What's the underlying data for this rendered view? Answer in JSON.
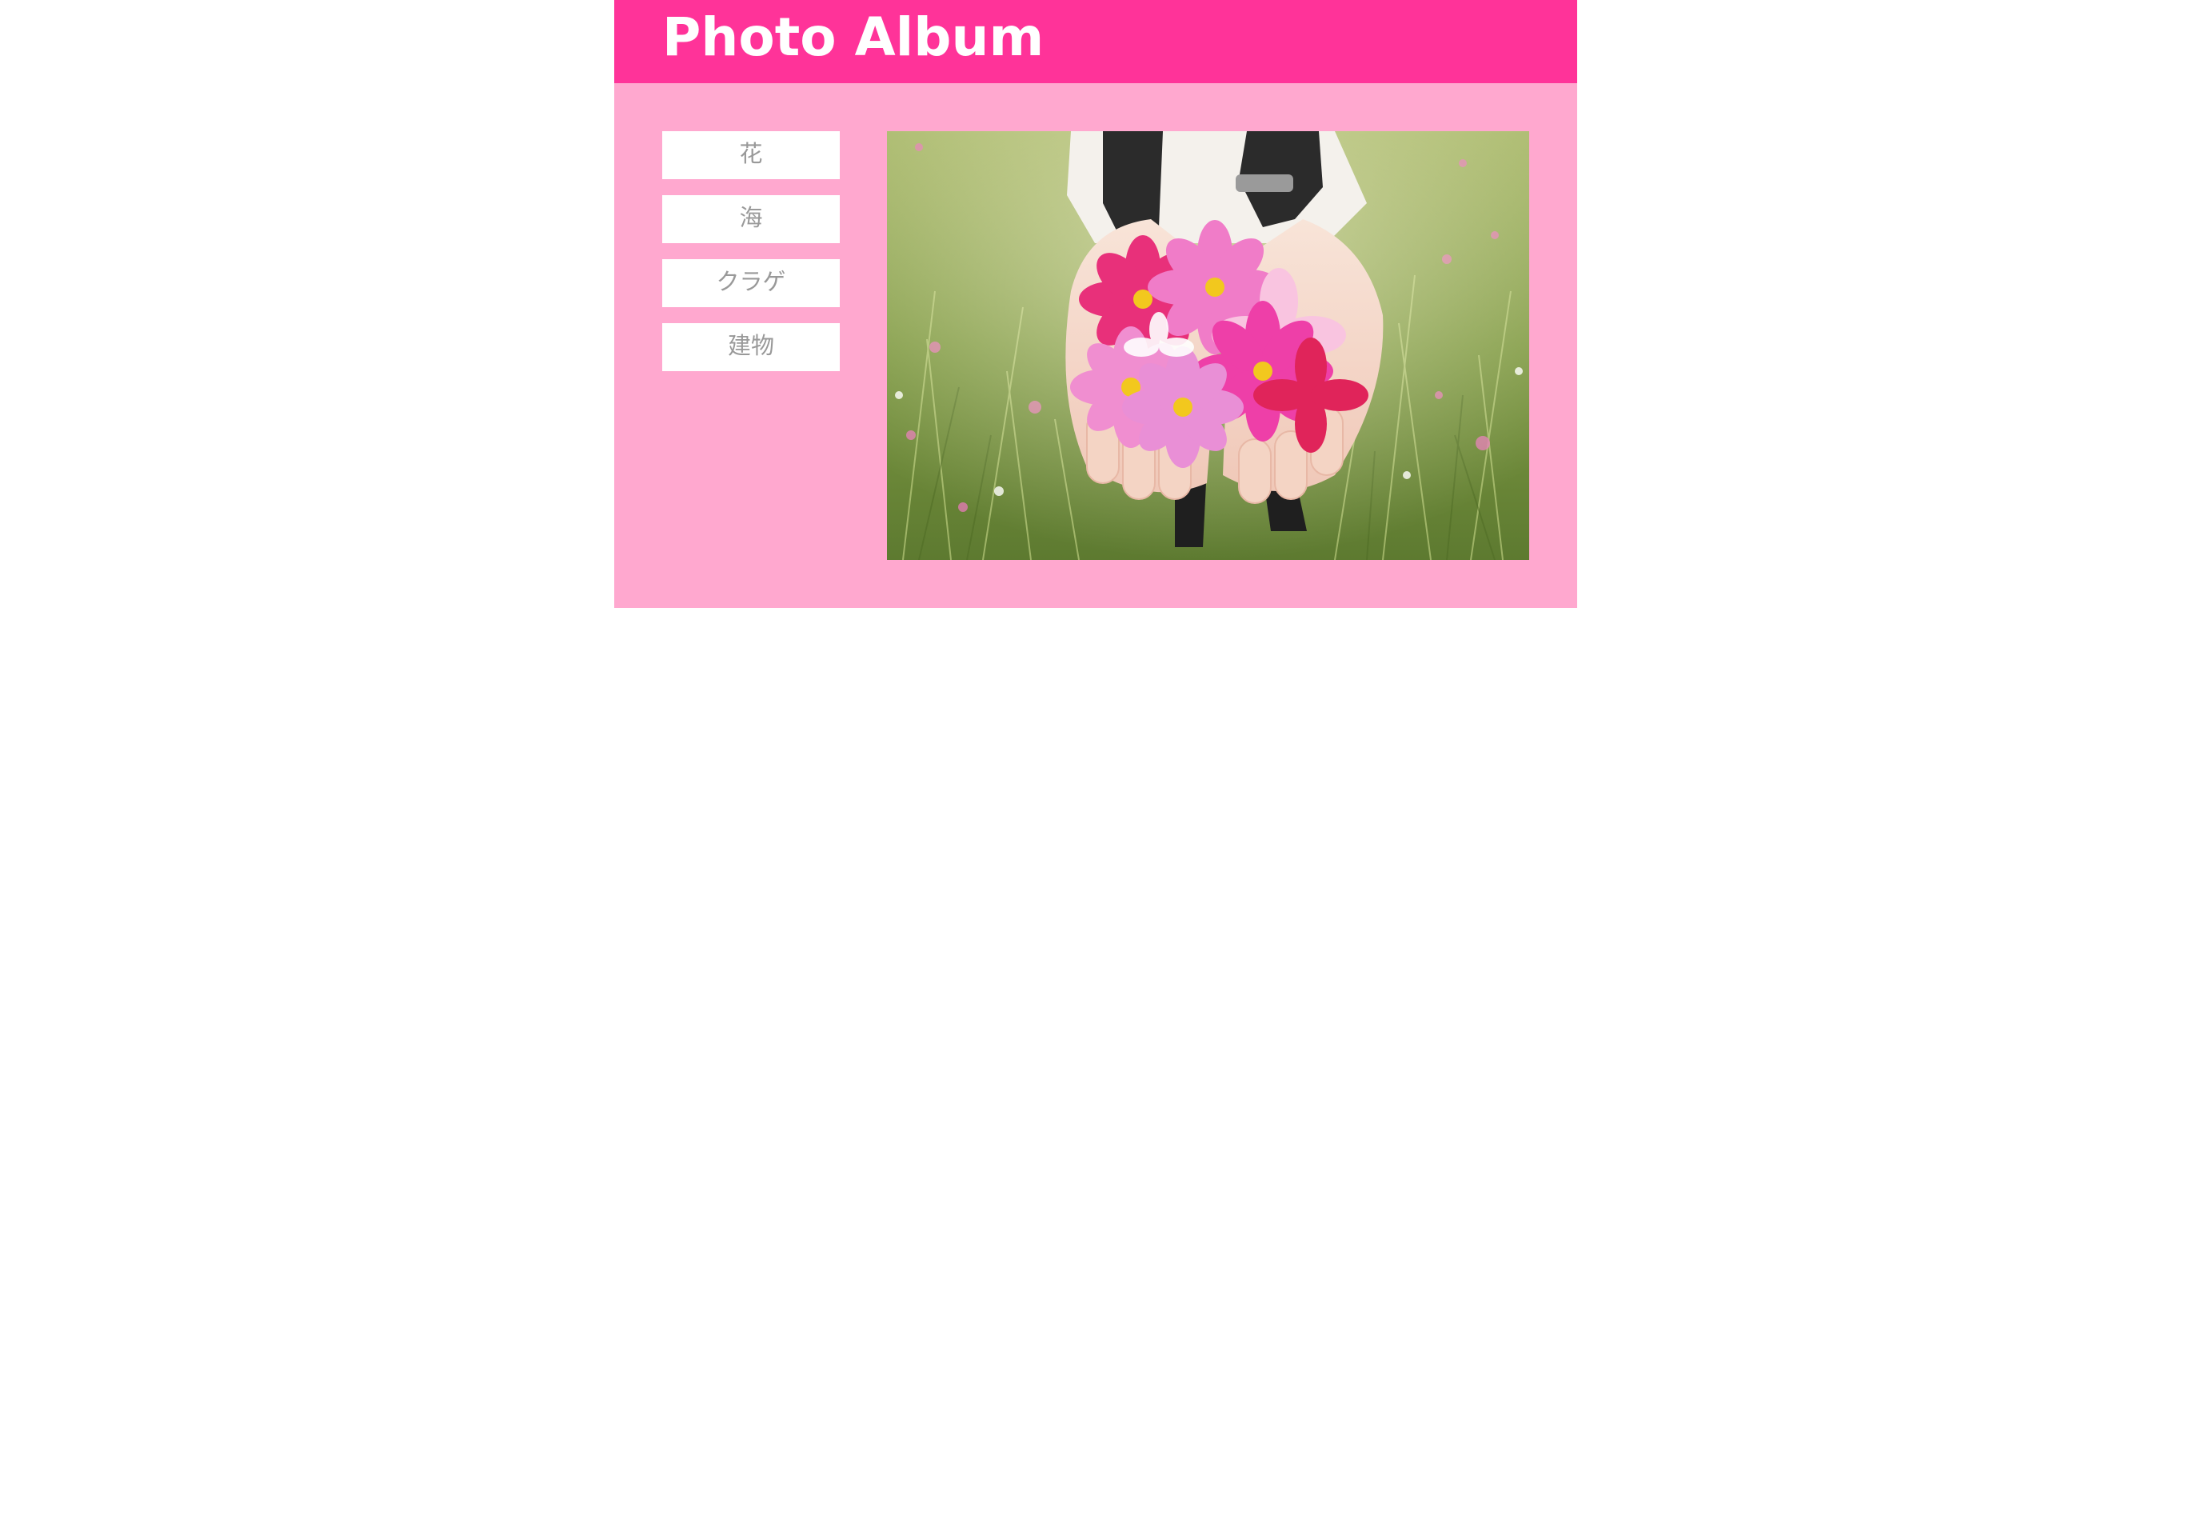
{
  "header": {
    "title": "Photo Album"
  },
  "menu": {
    "items": [
      {
        "label": "花"
      },
      {
        "label": "海"
      },
      {
        "label": "クラゲ"
      },
      {
        "label": "建物"
      }
    ]
  },
  "photo": {
    "subject": "flower"
  },
  "colors": {
    "header_bg": "#ff3399",
    "content_bg": "#ffa8cf",
    "menu_bg": "#ffffff",
    "menu_text": "#999999",
    "title_text": "#ffffff"
  }
}
